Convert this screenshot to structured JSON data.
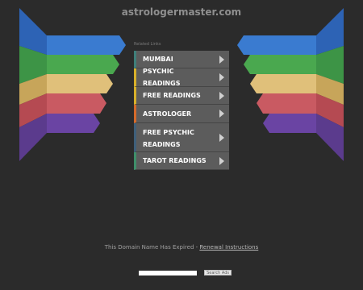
{
  "site": {
    "title": "astrologermaster.com"
  },
  "related_label": "Related Links",
  "menu": {
    "items": [
      {
        "label": "MUMBAI"
      },
      {
        "label": "PSYCHIC READINGS"
      },
      {
        "label": "FREE READINGS"
      },
      {
        "label": "ASTROLOGER"
      },
      {
        "label": "FREE PSYCHIC READINGS"
      },
      {
        "label": "TAROT READINGS"
      }
    ]
  },
  "footer": {
    "text": "This Domain Name Has Expired - ",
    "link": "Renewal Instructions"
  },
  "search": {
    "button_label": "Search Ads"
  },
  "colors": {
    "background": "#2b2b2b",
    "wing_blue": "#2f5ea8",
    "wing_green": "#3e8a3e",
    "wing_yellow": "#c9a64a",
    "wing_red": "#b0484a",
    "wing_purple": "#5a3a88"
  }
}
